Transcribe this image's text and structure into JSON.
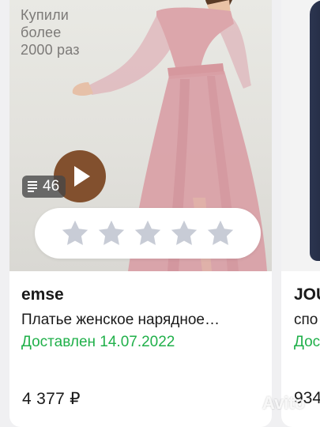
{
  "card1": {
    "promo": [
      "Купили",
      "более",
      "2000 раз"
    ],
    "photo_count": "46",
    "rating": {
      "stars_total": 5,
      "stars_filled": 0
    },
    "brand": "emse",
    "title": "Платье женское нарядное…",
    "status": "Доставлен 14.07.2022",
    "price": "4 377 ₽"
  },
  "card2": {
    "brand": "JOU",
    "title": "спо",
    "status": "Дос",
    "price": "934"
  },
  "watermark": "Avito",
  "colors": {
    "status_green": "#20b04a",
    "play_button": "#82502e",
    "star_empty": "#c8ccd6"
  }
}
